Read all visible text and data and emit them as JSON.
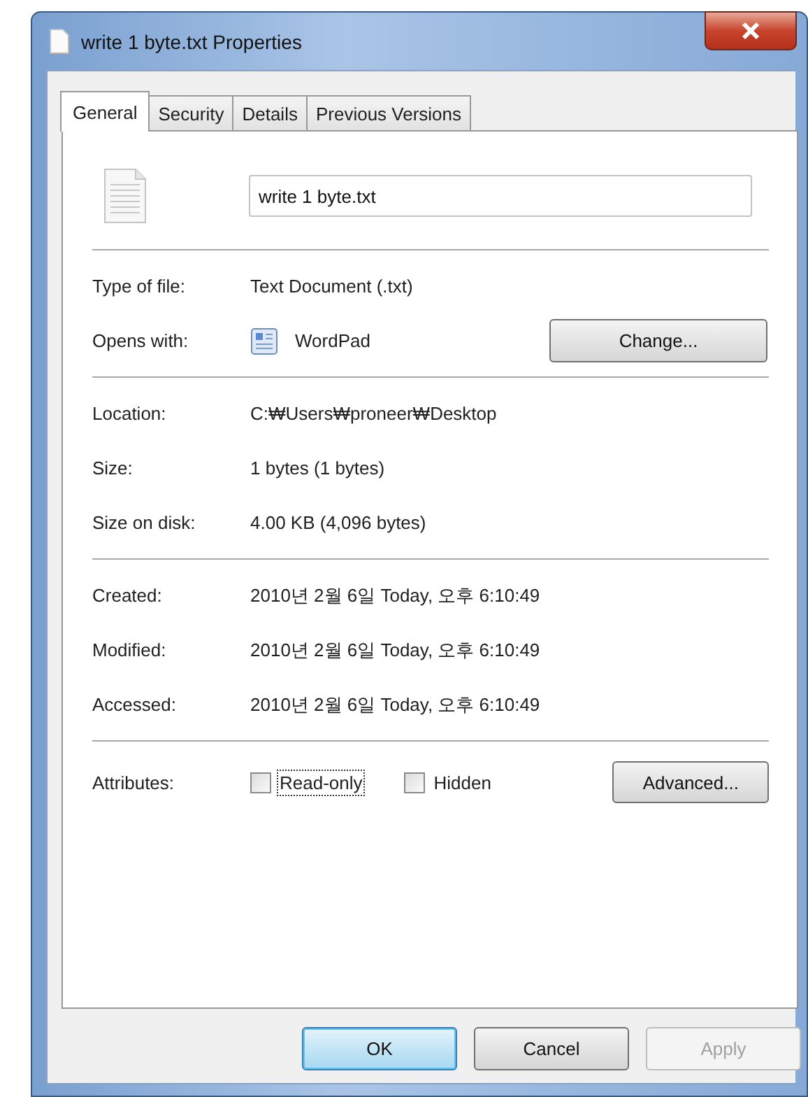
{
  "window": {
    "title": "write 1 byte.txt Properties"
  },
  "tabs": [
    {
      "label": "General",
      "selected": true
    },
    {
      "label": "Security",
      "selected": false
    },
    {
      "label": "Details",
      "selected": false
    },
    {
      "label": "Previous Versions",
      "selected": false
    }
  ],
  "file_name": "write 1 byte.txt",
  "sections": [
    [
      {
        "kind": "text",
        "label": "Type of file:",
        "value": "Text Document (.txt)"
      },
      {
        "kind": "app",
        "label": "Opens with:",
        "value": "WordPad",
        "button": "Change..."
      }
    ],
    [
      {
        "kind": "text",
        "label": "Location:",
        "value": "C:₩Users₩proneer₩Desktop"
      },
      {
        "kind": "text",
        "label": "Size:",
        "value": "1 bytes (1 bytes)"
      },
      {
        "kind": "text",
        "label": "Size on disk:",
        "value": "4.00 KB (4,096 bytes)"
      }
    ],
    [
      {
        "kind": "text",
        "label": "Created:",
        "value": "2010년 2월 6일 Today, 오후 6:10:49"
      },
      {
        "kind": "text",
        "label": "Modified:",
        "value": "2010년 2월 6일 Today, 오후 6:10:49"
      },
      {
        "kind": "text",
        "label": "Accessed:",
        "value": "2010년 2월 6일 Today, 오후 6:10:49"
      }
    ]
  ],
  "attributes": {
    "label": "Attributes:",
    "options": [
      {
        "label": "Read-only",
        "checked": false,
        "focused": true
      },
      {
        "label": "Hidden",
        "checked": false,
        "focused": false
      }
    ],
    "button": "Advanced..."
  },
  "buttons": [
    {
      "label": "OK",
      "default": true,
      "disabled": false
    },
    {
      "label": "Cancel",
      "default": false,
      "disabled": false
    },
    {
      "label": "Apply",
      "default": false,
      "disabled": true
    }
  ]
}
